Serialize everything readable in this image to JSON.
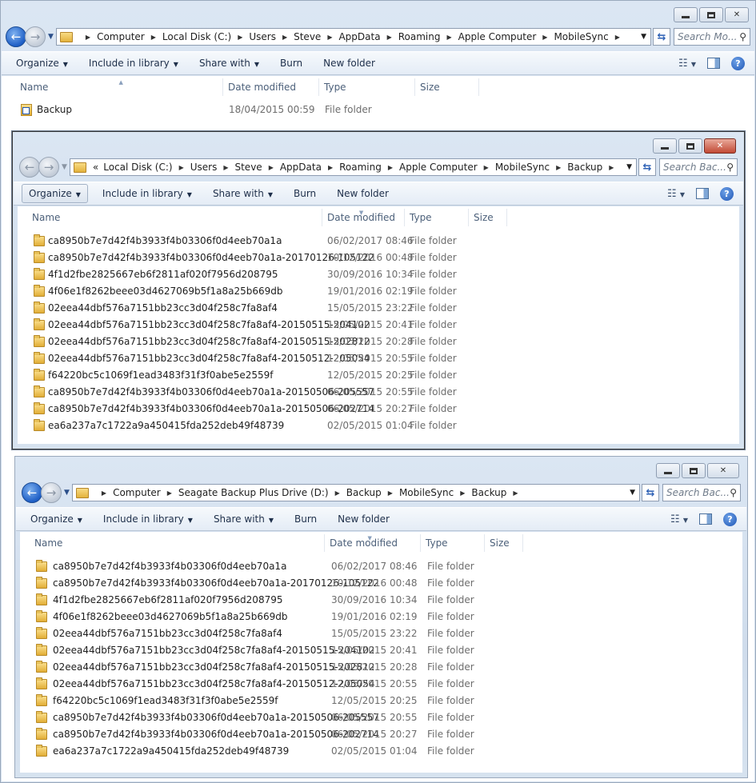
{
  "windows": [
    {
      "id": "appdata",
      "breadcrumbs": [
        "Computer",
        "Local Disk (C:)",
        "Users",
        "Steve",
        "AppData",
        "Roaming",
        "Apple Computer",
        "MobileSync"
      ],
      "search_placeholder": "Search Mo...",
      "toolbar": [
        "Organize",
        "Include in library",
        "Share with",
        "Burn",
        "New folder"
      ],
      "columns": [
        "Name",
        "Date modified",
        "Type",
        "Size"
      ],
      "rows": [
        {
          "name": "Backup",
          "date": "18/04/2015 00:59",
          "type": "File folder",
          "shortcut": true
        }
      ]
    },
    {
      "id": "local-backup",
      "overflow_prefix": "«",
      "breadcrumbs": [
        "Local Disk (C:)",
        "Users",
        "Steve",
        "AppData",
        "Roaming",
        "Apple Computer",
        "MobileSync",
        "Backup"
      ],
      "search_placeholder": "Search Bac...",
      "toolbar": [
        "Organize",
        "Include in library",
        "Share with",
        "Burn",
        "New folder"
      ],
      "columns": [
        "Name",
        "Date modified",
        "Type",
        "Size"
      ],
      "rows": [
        {
          "name": "ca8950b7e7d42f4b3933f4b03306f0d4eeb70a1a",
          "date": "06/02/2017 08:46",
          "type": "File folder"
        },
        {
          "name": "ca8950b7e7d42f4b3933f4b03306f0d4eeb70a1a-20170126-105122",
          "date": "10/12/2016 00:48",
          "type": "File folder"
        },
        {
          "name": "4f1d2fbe2825667eb6f2811af020f7956d208795",
          "date": "30/09/2016 10:34",
          "type": "File folder"
        },
        {
          "name": "4f06e1f8262beee03d4627069b5f1a8a25b669db",
          "date": "19/01/2016 02:19",
          "type": "File folder"
        },
        {
          "name": "02eea44dbf576a7151bb23cc3d04f258c7fa8af4",
          "date": "15/05/2015 23:22",
          "type": "File folder"
        },
        {
          "name": "02eea44dbf576a7151bb23cc3d04f258c7fa8af4-20150515-204102",
          "date": "15/05/2015 20:41",
          "type": "File folder"
        },
        {
          "name": "02eea44dbf576a7151bb23cc3d04f258c7fa8af4-20150515-202812",
          "date": "15/05/2015 20:28",
          "type": "File folder"
        },
        {
          "name": "02eea44dbf576a7151bb23cc3d04f258c7fa8af4-20150512-205054",
          "date": "12/05/2015 20:55",
          "type": "File folder"
        },
        {
          "name": "f64220bc5c1069f1ead3483f31f3f0abe5e2559f",
          "date": "12/05/2015 20:25",
          "type": "File folder"
        },
        {
          "name": "ca8950b7e7d42f4b3933f4b03306f0d4eeb70a1a-20150506-205557",
          "date": "06/05/2015 20:55",
          "type": "File folder"
        },
        {
          "name": "ca8950b7e7d42f4b3933f4b03306f0d4eeb70a1a-20150506-202714",
          "date": "06/05/2015 20:27",
          "type": "File folder"
        },
        {
          "name": "ea6a237a7c1722a9a450415fda252deb49f48739",
          "date": "02/05/2015 01:04",
          "type": "File folder"
        }
      ]
    },
    {
      "id": "drive-backup",
      "breadcrumbs": [
        "Computer",
        "Seagate Backup Plus Drive (D:)",
        "Backup",
        "MobileSync",
        "Backup"
      ],
      "search_placeholder": "Search Bac...",
      "toolbar": [
        "Organize",
        "Include in library",
        "Share with",
        "Burn",
        "New folder"
      ],
      "columns": [
        "Name",
        "Date modified",
        "Type",
        "Size"
      ],
      "rows": [
        {
          "name": "ca8950b7e7d42f4b3933f4b03306f0d4eeb70a1a",
          "date": "06/02/2017 08:46",
          "type": "File folder"
        },
        {
          "name": "ca8950b7e7d42f4b3933f4b03306f0d4eeb70a1a-20170126-105122",
          "date": "10/12/2016 00:48",
          "type": "File folder"
        },
        {
          "name": "4f1d2fbe2825667eb6f2811af020f7956d208795",
          "date": "30/09/2016 10:34",
          "type": "File folder"
        },
        {
          "name": "4f06e1f8262beee03d4627069b5f1a8a25b669db",
          "date": "19/01/2016 02:19",
          "type": "File folder"
        },
        {
          "name": "02eea44dbf576a7151bb23cc3d04f258c7fa8af4",
          "date": "15/05/2015 23:22",
          "type": "File folder"
        },
        {
          "name": "02eea44dbf576a7151bb23cc3d04f258c7fa8af4-20150515-204102",
          "date": "15/05/2015 20:41",
          "type": "File folder"
        },
        {
          "name": "02eea44dbf576a7151bb23cc3d04f258c7fa8af4-20150515-202812",
          "date": "15/05/2015 20:28",
          "type": "File folder"
        },
        {
          "name": "02eea44dbf576a7151bb23cc3d04f258c7fa8af4-20150512-205054",
          "date": "12/05/2015 20:55",
          "type": "File folder"
        },
        {
          "name": "f64220bc5c1069f1ead3483f31f3f0abe5e2559f",
          "date": "12/05/2015 20:25",
          "type": "File folder"
        },
        {
          "name": "ca8950b7e7d42f4b3933f4b03306f0d4eeb70a1a-20150506-205557",
          "date": "06/05/2015 20:55",
          "type": "File folder"
        },
        {
          "name": "ca8950b7e7d42f4b3933f4b03306f0d4eeb70a1a-20150506-202714",
          "date": "06/05/2015 20:27",
          "type": "File folder"
        },
        {
          "name": "ea6a237a7c1722a9a450415fda252deb49f48739",
          "date": "02/05/2015 01:04",
          "type": "File folder"
        }
      ]
    }
  ]
}
